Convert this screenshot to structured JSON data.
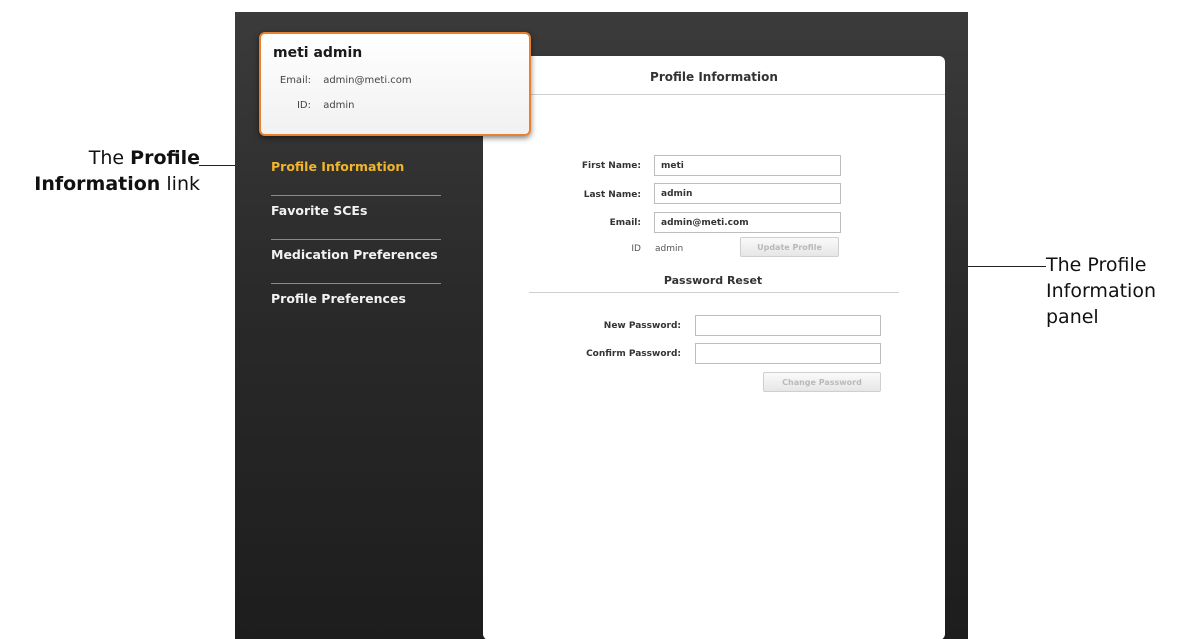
{
  "callouts": {
    "link_prefix": "The ",
    "link_bold": "Profile Information",
    "link_suffix": " link",
    "panel": "The Profile Information panel"
  },
  "user_card": {
    "name": "meti admin",
    "email_label": "Email:",
    "email_value": "admin@meti.com",
    "id_label": "ID:",
    "id_value": "admin"
  },
  "sidebar": {
    "items": [
      {
        "label": "Profile Information",
        "active": true
      },
      {
        "label": "Favorite SCEs",
        "active": false
      },
      {
        "label": "Medication Preferences",
        "active": false
      },
      {
        "label": "Profile Preferences",
        "active": false
      }
    ]
  },
  "panel": {
    "title": "Profile Information",
    "first_name_label": "First Name:",
    "first_name_value": "meti",
    "last_name_label": "Last Name:",
    "last_name_value": "admin",
    "email_label": "Email:",
    "email_value": "admin@meti.com",
    "id_label": "ID",
    "id_value": "admin",
    "update_button": "Update Profile",
    "password_section_title": "Password Reset",
    "new_password_label": "New Password:",
    "new_password_value": "",
    "confirm_password_label": "Confirm Password:",
    "confirm_password_value": "",
    "change_password_button": "Change Password"
  },
  "colors": {
    "accent_orange": "#e9802d",
    "active_nav": "#f0b52a",
    "background_dark": "#2a2a2a",
    "panel_white": "#ffffff"
  }
}
